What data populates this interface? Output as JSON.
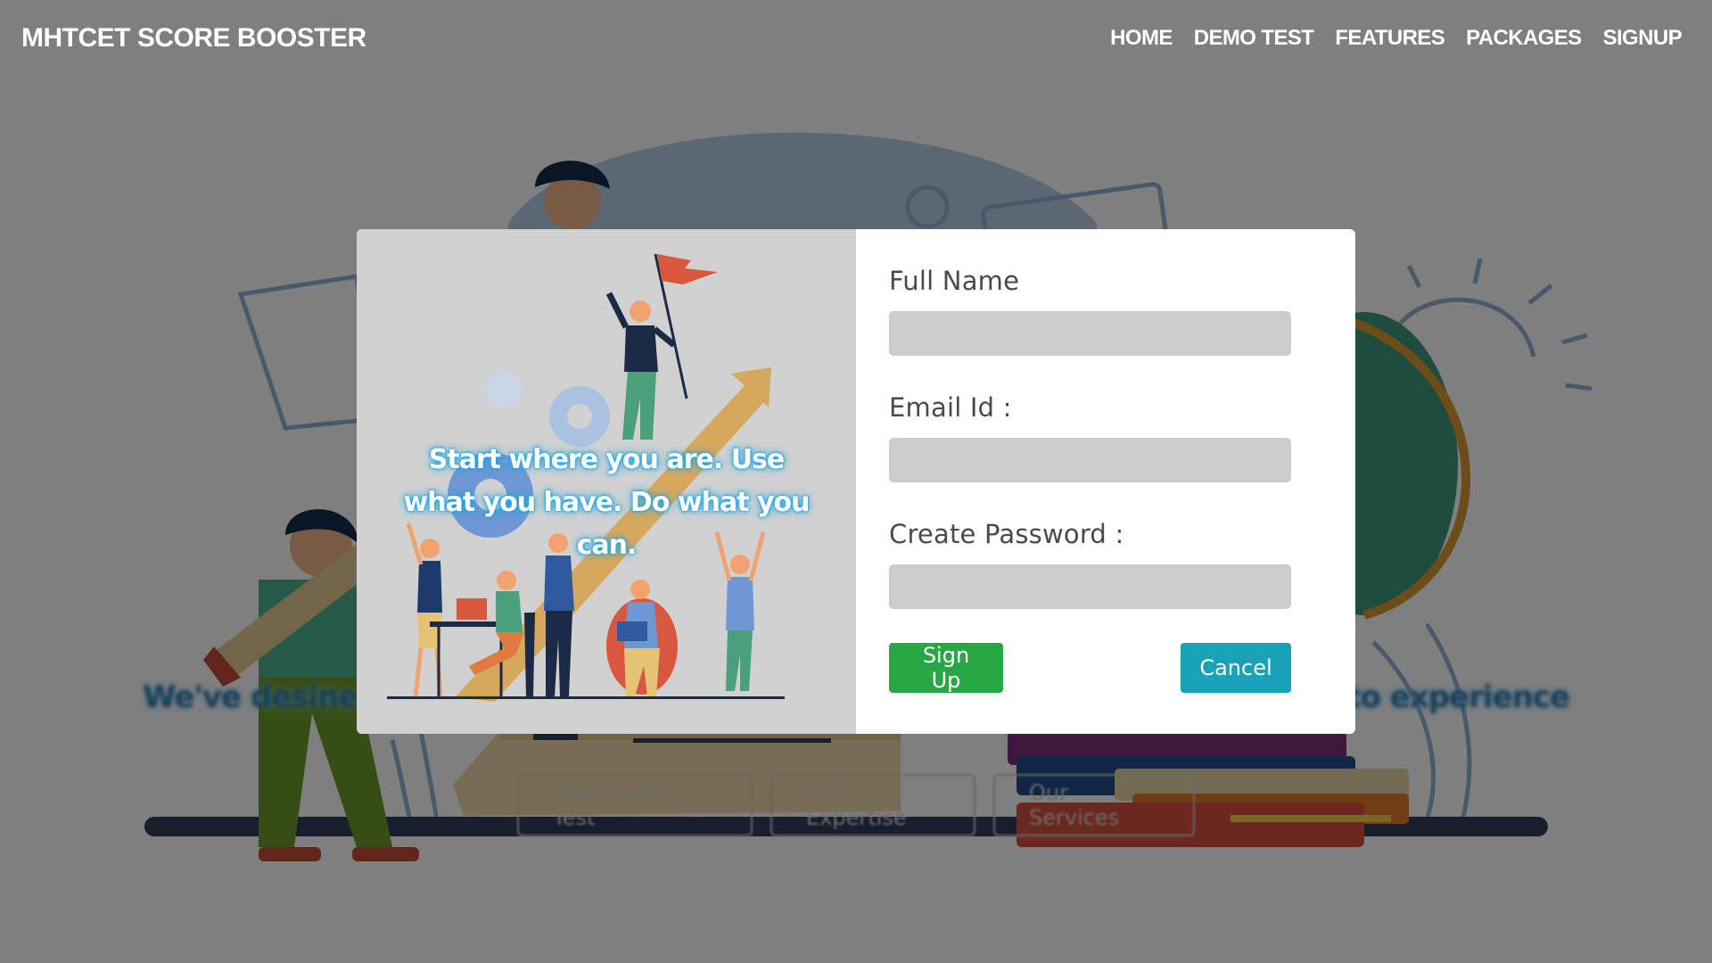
{
  "navbar": {
    "brand": "MHTCET SCORE BOOSTER",
    "links": [
      "HOME",
      "DEMO TEST",
      "FEATURES",
      "PACKAGES",
      "SIGNUP"
    ]
  },
  "hero": {
    "tagline_left": "We've desined t",
    "tagline_right": "e to experience",
    "buttons": [
      "Take Demo Test",
      "Our Expertise",
      "Our Services"
    ]
  },
  "modal": {
    "quote": "Start where you are. Use what you have. Do what you can.",
    "fields": [
      {
        "label": "Full Name",
        "value": ""
      },
      {
        "label": "Email Id :",
        "value": ""
      },
      {
        "label": "Create Password :",
        "value": ""
      }
    ],
    "signup_label": "Sign Up",
    "cancel_label": "Cancel"
  },
  "colors": {
    "overlay": "#000000",
    "signup_button": "#28a745",
    "cancel_button": "#17a2b8",
    "input_bg": "#cccccc",
    "modal_left_bg": "#d1d1d1",
    "quote_glow": "#1aa7e6"
  }
}
